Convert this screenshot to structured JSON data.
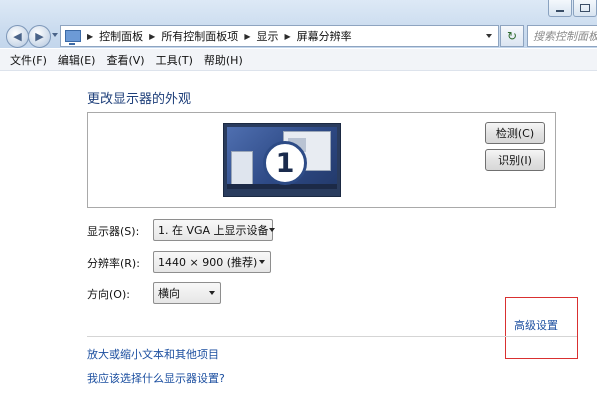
{
  "address_bar": {
    "breadcrumbs": [
      "控制面板",
      "所有控制面板项",
      "显示",
      "屏幕分辨率"
    ],
    "search_placeholder": "搜索控制面板"
  },
  "menu": {
    "items": [
      "文件(F)",
      "编辑(E)",
      "查看(V)",
      "工具(T)",
      "帮助(H)"
    ]
  },
  "main": {
    "heading": "更改显示器的外观",
    "display_number": "1",
    "detect_label": "检测(C)",
    "identify_label": "识别(I)",
    "display_label": "显示器(S):",
    "display_value": "1. 在 VGA 上显示设备",
    "resolution_label": "分辨率(R):",
    "resolution_value": "1440 × 900 (推荐)",
    "orientation_label": "方向(O):",
    "orientation_value": "横向",
    "advanced_link": "高级设置",
    "link_text_size": "放大或缩小文本和其他项目",
    "link_which_settings": "我应该选择什么显示器设置?"
  },
  "colors": {
    "link": "#1c4fa0",
    "heading": "#1e3f7a",
    "highlight_box": "#d93030"
  }
}
